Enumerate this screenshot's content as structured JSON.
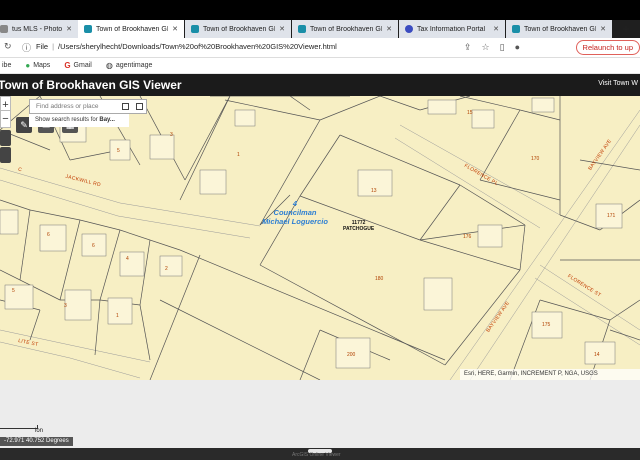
{
  "tabs": [
    {
      "label": "tus MLS - Photos - No",
      "favicon_color": "#888888"
    },
    {
      "label": "Town of Brookhaven GIS V",
      "favicon_color": "#1a8fa8",
      "active": true
    },
    {
      "label": "Town of Brookhaven GIS V",
      "favicon_color": "#1a8fa8"
    },
    {
      "label": "Town of Brookhaven GIS V",
      "favicon_color": "#1a8fa8"
    },
    {
      "label": "Tax Information Portal",
      "favicon_color": "#3b4cc0"
    },
    {
      "label": "Town of Brookhaven GIS V",
      "favicon_color": "#1a8fa8"
    }
  ],
  "address": {
    "scheme_label": "File",
    "url": "/Users/sherylhecht/Downloads/Town%20of%20Brookhaven%20GIS%20Viewer.html",
    "relaunch_label": "Relaunch to up"
  },
  "bookmarks": [
    {
      "label": "ibe",
      "icon": ""
    },
    {
      "label": "Maps",
      "icon": "map-pin-icon"
    },
    {
      "label": "Gmail",
      "icon": "gmail-icon"
    },
    {
      "label": "agentimage",
      "icon": "globe-icon"
    }
  ],
  "app": {
    "title": "Town of Brookhaven GIS Viewer",
    "visit_link": "Visit Town W"
  },
  "map": {
    "search_placeholder": "Find address or place",
    "search_hint_prefix": "Show search results for ",
    "search_hint_bold": "Bay...",
    "district_number": "4",
    "district_line1": "Councilman",
    "district_line2": "Michael Loguercio",
    "patch_code": "11772",
    "patch_name": "PATCHOGUE",
    "attribution": "Esri, HERE, Garmin, INCREMENT P, NGA, USGS",
    "streets": {
      "jackwill": "JACKWILL RD",
      "jackwill_c": "C",
      "florence_pl": "FLORENCE PL",
      "florence_st": "FLORENCE ST",
      "bayview": "BAYVIEW AVE",
      "bayview2": "BAYVIEW AVE",
      "lite": "LITE ST"
    },
    "parcels": [
      {
        "label": "15"
      },
      {
        "label": "170"
      },
      {
        "label": "3"
      },
      {
        "label": "5"
      },
      {
        "label": "1"
      },
      {
        "label": "13"
      },
      {
        "label": "171"
      },
      {
        "label": "176"
      },
      {
        "label": "6"
      },
      {
        "label": "6"
      },
      {
        "label": "4"
      },
      {
        "label": "2"
      },
      {
        "label": "5"
      },
      {
        "label": "3"
      },
      {
        "label": "1"
      },
      {
        "label": "180"
      },
      {
        "label": "175"
      },
      {
        "label": "200"
      },
      {
        "label": "14"
      }
    ]
  },
  "footer": {
    "scale_label": "ion",
    "coordinates": "-72.971 40.752 Degrees",
    "bottom_text": "ArcGIS Online Viewer"
  }
}
